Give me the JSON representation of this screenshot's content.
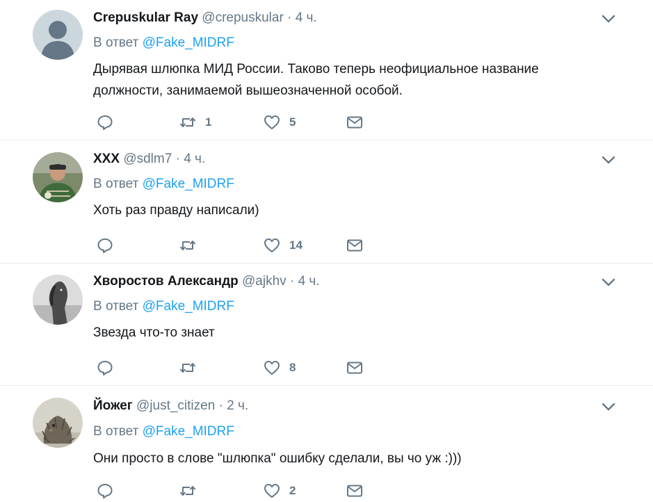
{
  "reply_prefix": "В ответ",
  "reply_to": "@Fake_MIDRF",
  "tweets": [
    {
      "name": "Crepuskular Ray",
      "handle": "@crepuskular",
      "dot": "·",
      "time": "4 ч.",
      "text_lines": [
        "Дырявая шлюпка МИД России. Таково теперь неофициальное название",
        "должности, занимаемой вышеозначенной особой."
      ],
      "retweets": "1",
      "likes": "5"
    },
    {
      "name": "XXX",
      "handle": "@sdlm7",
      "dot": "·",
      "time": "4 ч.",
      "text_lines": [
        "Хоть раз правду написали)"
      ],
      "retweets": "",
      "likes": "14"
    },
    {
      "name": "Хворостов Александр",
      "handle": "@ajkhv",
      "dot": "·",
      "time": "4 ч.",
      "text_lines": [
        "Звезда что-то знает"
      ],
      "retweets": "",
      "likes": "8"
    },
    {
      "name": "Йожег",
      "handle": "@just_citizen",
      "dot": "·",
      "time": "2 ч.",
      "text_lines": [
        "Они просто в слове \"шлюпка\" ошибку сделали, вы чо уж :)))"
      ],
      "retweets": "",
      "likes": "2"
    }
  ],
  "colors": {
    "text": "#14171a",
    "secondary": "#657786",
    "link": "#1da1f2",
    "divider": "#e6ecf0"
  }
}
